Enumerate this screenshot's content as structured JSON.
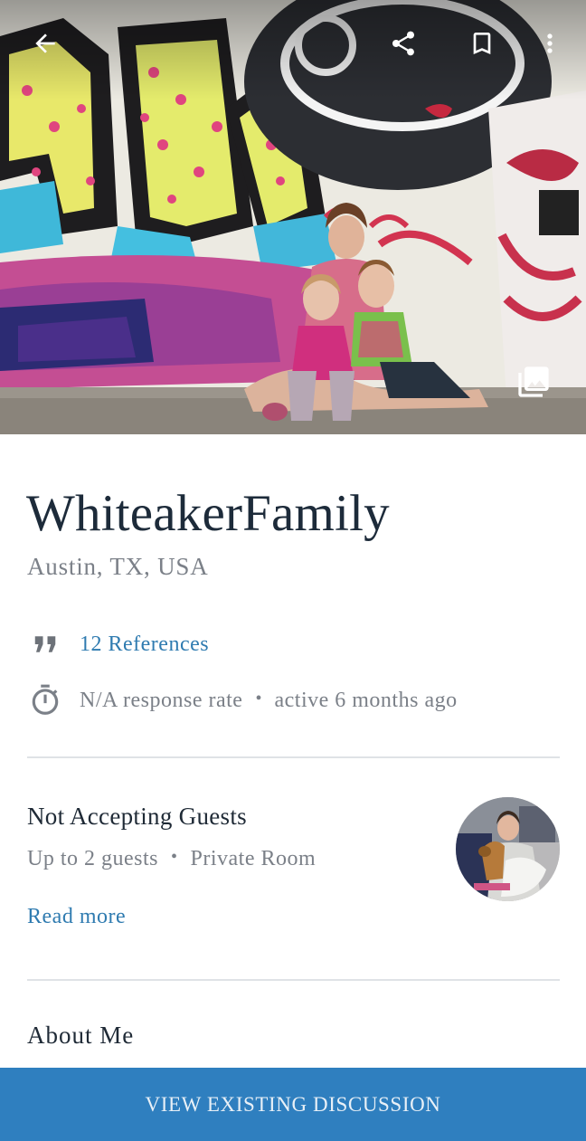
{
  "hero": {
    "icons": {
      "back": "arrow-back-icon",
      "share": "share-icon",
      "bookmark": "bookmark-icon",
      "more": "more-vertical-icon",
      "gallery": "photo-gallery-icon"
    }
  },
  "profile": {
    "username": "WhiteakerFamily",
    "location": "Austin, TX, USA",
    "references": "12 References",
    "response_rate": "N/A response rate",
    "separator": "•",
    "last_active": "active 6 months ago",
    "icons": {
      "references": "quote-icon",
      "response": "stopwatch-icon"
    }
  },
  "hosting": {
    "status": "Not Accepting Guests",
    "guests": "Up to 2 guests",
    "room_type": "Private Room",
    "read_more": "Read more"
  },
  "about": {
    "title": "About Me"
  },
  "action": {
    "label": "VIEW EXISTING DISCUSSION"
  },
  "colors": {
    "accent": "#2f7fbf",
    "link": "#2f7bb0",
    "text_primary": "#1d2b3a",
    "text_secondary": "#7b8088",
    "divider": "#dfe2e6"
  }
}
